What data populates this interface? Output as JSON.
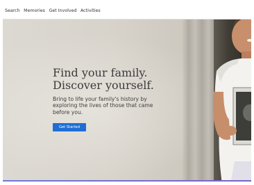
{
  "nav": {
    "items": [
      {
        "label": "Search"
      },
      {
        "label": "Memories"
      },
      {
        "label": "Get Involved"
      },
      {
        "label": "Activities"
      }
    ]
  },
  "hero": {
    "headline_line1": "Find your family.",
    "headline_line2": "Discover yourself.",
    "subtext": "Bring to life your family's history by exploring the lives of those that came before you.",
    "cta_label": "Get Started"
  },
  "colors": {
    "cta_background": "#1f6ed4",
    "accent_line": "#6e7bd8",
    "headline_text": "#3b3b3b"
  }
}
